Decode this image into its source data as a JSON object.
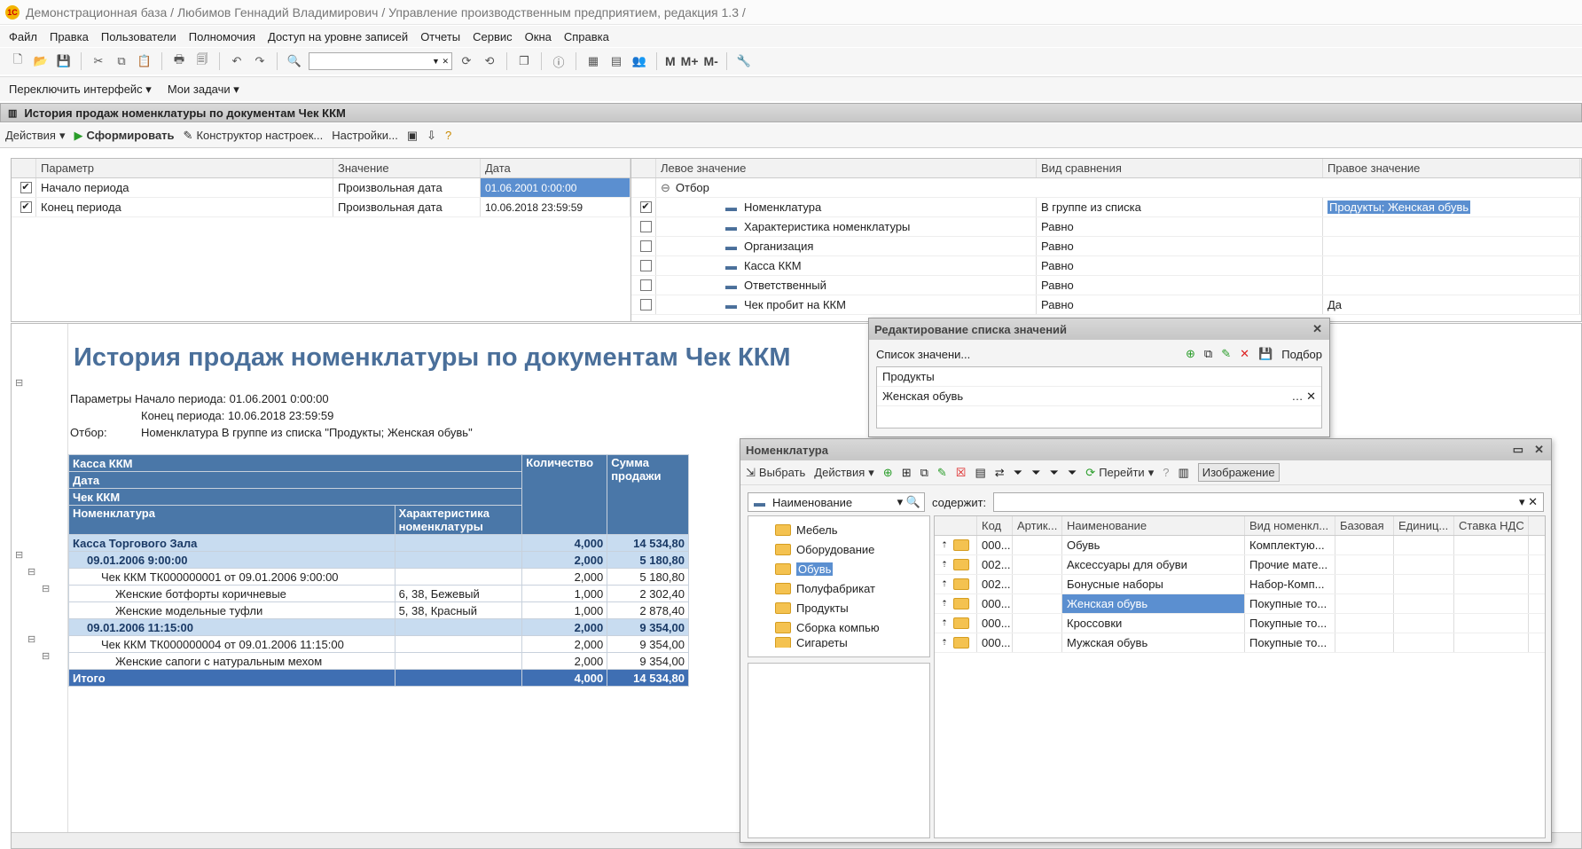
{
  "window_title": "Демонстрационная база / Любимов Геннадий Владимирович /  Управление производственным предприятием, редакция 1.3 /",
  "logo_text": "1С",
  "menu": [
    "Файл",
    "Правка",
    "Пользователи",
    "Полномочия",
    "Доступ на уровне записей",
    "Отчеты",
    "Сервис",
    "Окна",
    "Справка"
  ],
  "toolbar": {
    "m": "M",
    "mplus": "M+",
    "mminus": "M-"
  },
  "secbar": {
    "switch": "Переключить интерфейс",
    "tasks": "Мои задачи"
  },
  "report_window_title": "История продаж номенклатуры по документам Чек ККМ",
  "cmd": {
    "actions": "Действия",
    "generate": "Сформировать",
    "constructor": "Конструктор настроек...",
    "settings": "Настройки..."
  },
  "params": {
    "headers": [
      "Параметр",
      "Значение",
      "Дата"
    ],
    "rows": [
      {
        "checked": "✔",
        "name": "Начало периода",
        "value": "Произвольная дата",
        "date": "01.06.2001 0:00:00"
      },
      {
        "checked": "✔",
        "name": "Конец периода",
        "value": "Произвольная дата",
        "date": "10.06.2018 23:59:59"
      }
    ]
  },
  "filter": {
    "headers": [
      "Левое значение",
      "Вид сравнения",
      "Правое значение"
    ],
    "group": "Отбор",
    "rows": [
      {
        "checked": "✔",
        "left": "Номенклатура",
        "cmp": "В группе из списка",
        "right": "Продукты; Женская обувь"
      },
      {
        "checked": "",
        "left": "Характеристика номенклатуры",
        "cmp": "Равно",
        "right": ""
      },
      {
        "checked": "",
        "left": "Организация",
        "cmp": "Равно",
        "right": ""
      },
      {
        "checked": "",
        "left": "Касса ККМ",
        "cmp": "Равно",
        "right": ""
      },
      {
        "checked": "",
        "left": "Ответственный",
        "cmp": "Равно",
        "right": ""
      },
      {
        "checked": "",
        "left": "Чек пробит на ККМ",
        "cmp": "Равно",
        "right": "Да"
      }
    ]
  },
  "report": {
    "title": "История продаж номенклатуры по документам Чек ККМ",
    "p1_label": "Параметры",
    "p1": "Начало периода: 01.06.2001 0:00:00",
    "p2": "Конец периода: 10.06.2018 23:59:59",
    "f_label": "Отбор:",
    "f": "Номенклатура В группе из списка \"Продукты; Женская обувь\"",
    "h1": "Касса ККМ",
    "h2": "Дата",
    "h3": "Чек ККМ",
    "h4": "Номенклатура",
    "h5": "Характеристика номенклатуры",
    "hq": "Количество",
    "hs": "Сумма продажи",
    "rows": [
      {
        "cls": "rgrp",
        "name": "Касса Торгового Зала",
        "ch": "",
        "q": "4,000",
        "s": "14 534,80",
        "ind": 0
      },
      {
        "cls": "rgrp",
        "name": "09.01.2006 9:00:00",
        "ch": "",
        "q": "2,000",
        "s": "5 180,80",
        "ind": 1
      },
      {
        "cls": "",
        "name": "Чек ККМ ТК000000001 от 09.01.2006 9:00:00",
        "ch": "",
        "q": "2,000",
        "s": "5 180,80",
        "ind": 2
      },
      {
        "cls": "",
        "name": "Женские ботфорты коричневые",
        "ch": "6, 38, Бежевый",
        "q": "1,000",
        "s": "2 302,40",
        "ind": 3
      },
      {
        "cls": "",
        "name": "Женские модельные туфли",
        "ch": "5, 38, Красный",
        "q": "1,000",
        "s": "2 878,40",
        "ind": 3
      },
      {
        "cls": "rgrp",
        "name": "09.01.2006 11:15:00",
        "ch": "",
        "q": "2,000",
        "s": "9 354,00",
        "ind": 1
      },
      {
        "cls": "",
        "name": "Чек ККМ ТК000000004 от 09.01.2006 11:15:00",
        "ch": "",
        "q": "2,000",
        "s": "9 354,00",
        "ind": 2
      },
      {
        "cls": "",
        "name": "Женские сапоги с натуральным мехом",
        "ch": "",
        "q": "2,000",
        "s": "9 354,00",
        "ind": 3
      },
      {
        "cls": "rtot",
        "name": "Итого",
        "ch": "",
        "q": "4,000",
        "s": "14 534,80",
        "ind": 0
      }
    ]
  },
  "edit_dialog": {
    "title": "Редактирование списка значений",
    "label": "Список значени...",
    "pick": "Подбор",
    "items": [
      "Продукты",
      "Женская обувь"
    ]
  },
  "nomen": {
    "title": "Номенклатура",
    "select": "Выбрать",
    "actions": "Действия",
    "goto": "Перейти",
    "images": "Изображение",
    "search_field": "Наименование",
    "contains": "содержит:",
    "tree": [
      "Мебель",
      "Оборудование",
      "Обувь",
      "Полуфабрикат",
      "Продукты",
      "Сборка компью",
      "Сигареты"
    ],
    "headers": [
      "Код",
      "Артик...",
      "Наименование",
      "Вид номенкл...",
      "Базовая",
      "Единиц...",
      "Ставка НДС"
    ],
    "rows": [
      {
        "code": "000...",
        "name": "Обувь",
        "kind": "Комплектую..."
      },
      {
        "code": "002...",
        "name": "Аксессуары для обуви",
        "kind": "Прочие мате..."
      },
      {
        "code": "002...",
        "name": "Бонусные наборы",
        "kind": "Набор-Комп..."
      },
      {
        "code": "000...",
        "name": "Женская обувь",
        "kind": "Покупные то..."
      },
      {
        "code": "000...",
        "name": "Кроссовки",
        "kind": "Покупные то..."
      },
      {
        "code": "000...",
        "name": "Мужская обувь",
        "kind": "Покупные то..."
      }
    ]
  },
  "colors": {
    "report_header": "#4a77a8",
    "group_row": "#c8dcf0",
    "total_row": "#3f6fb3",
    "selection": "#5b8fd0"
  }
}
